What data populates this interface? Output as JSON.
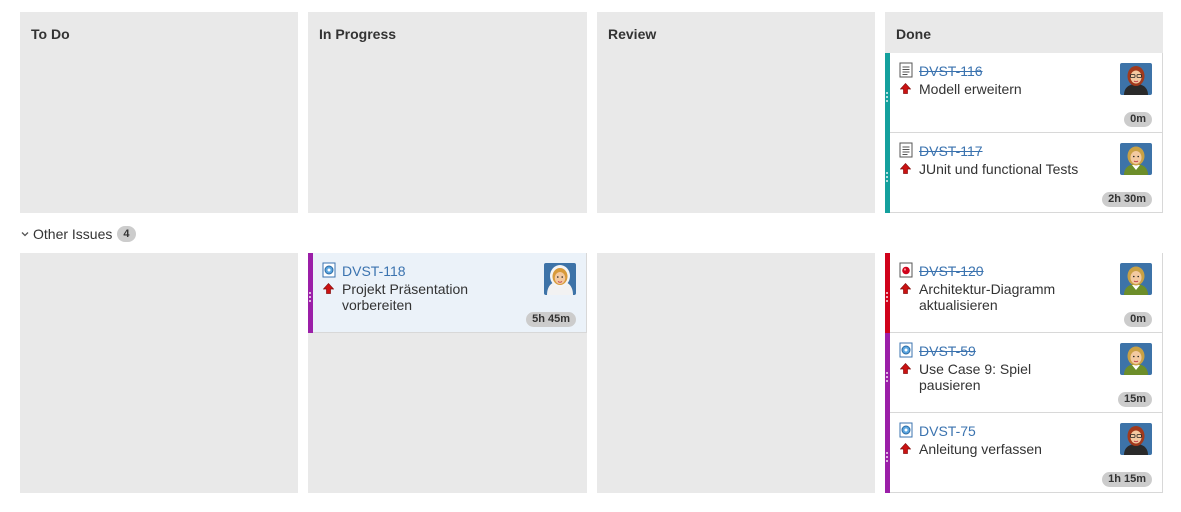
{
  "columns": [
    {
      "title": "To Do"
    },
    {
      "title": "In Progress"
    },
    {
      "title": "Review"
    },
    {
      "title": "Done"
    }
  ],
  "swimlane": {
    "label": "Other Issues",
    "count": "4"
  },
  "colors": {
    "teal": "#14a09d",
    "purple": "#9b1fa8",
    "red": "#d0021b",
    "link": "#3b73af",
    "column_bg": "#e9e9e9"
  },
  "cards": {
    "dvst116": {
      "key": "DVST-116",
      "summary": "Modell erweitern",
      "estimate": "0m",
      "type_icon": "task-icon",
      "priority": "major-priority-icon",
      "avatar": "avatar-woman-red-hair"
    },
    "dvst117": {
      "key": "DVST-117",
      "summary": "JUnit und functional Tests",
      "estimate": "2h 30m",
      "type_icon": "task-icon",
      "priority": "major-priority-icon",
      "avatar": "avatar-woman-blonde"
    },
    "dvst118": {
      "key": "DVST-118",
      "summary": "Projekt Präsentation vorbereiten",
      "estimate": "5h 45m",
      "type_icon": "improvement-icon",
      "priority": "major-priority-icon",
      "avatar": "avatar-woman-headscarf"
    },
    "dvst120": {
      "key": "DVST-120",
      "summary": "Architektur-Diagramm aktualisieren",
      "estimate": "0m",
      "type_icon": "bug-icon",
      "priority": "major-priority-icon",
      "avatar": "avatar-woman-blonde"
    },
    "dvst59": {
      "key": "DVST-59",
      "summary": "Use Case 9: Spiel pausieren",
      "estimate": "15m",
      "type_icon": "improvement-icon",
      "priority": "major-priority-icon",
      "avatar": "avatar-woman-blonde"
    },
    "dvst75": {
      "key": "DVST-75",
      "summary": "Anleitung verfassen",
      "estimate": "1h 15m",
      "type_icon": "improvement-icon",
      "priority": "major-priority-icon",
      "avatar": "avatar-woman-red-hair"
    }
  }
}
